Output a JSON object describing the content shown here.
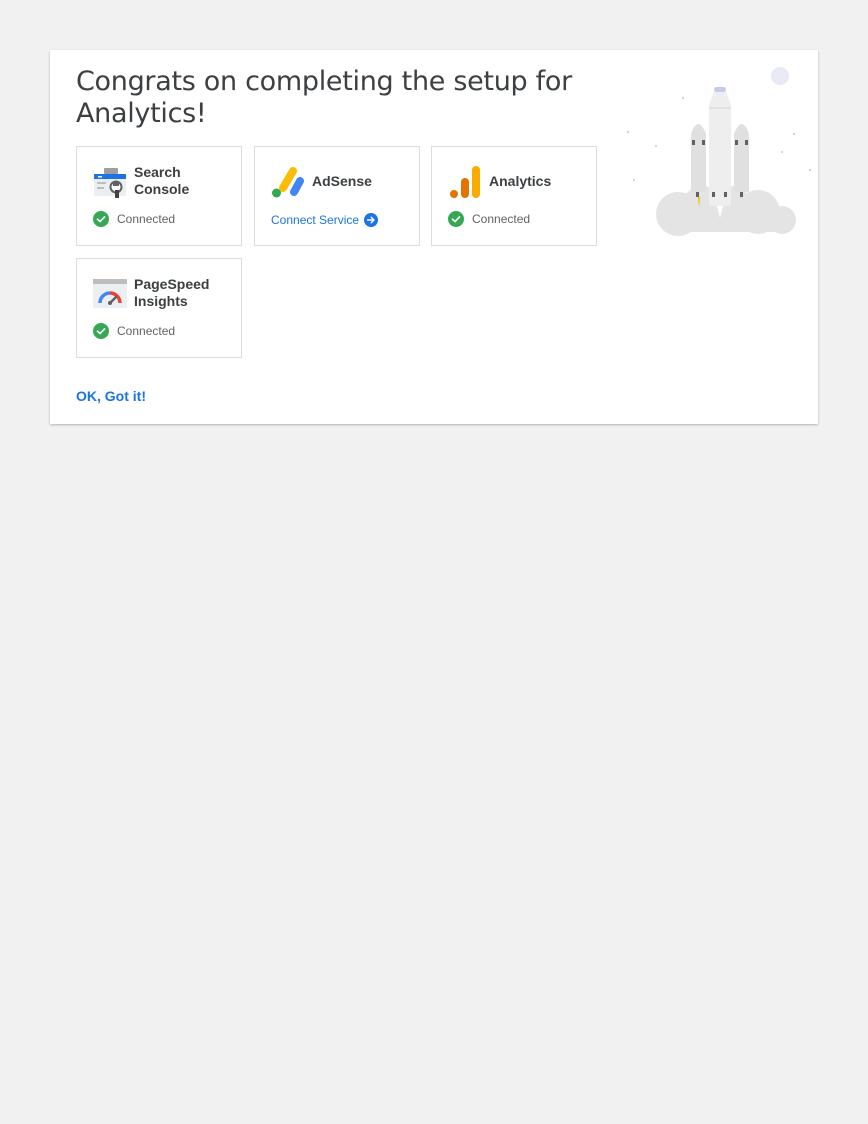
{
  "dialog": {
    "title": "Congrats on completing the setup for Analytics!",
    "ok_label": "OK, Got it!"
  },
  "services": [
    {
      "name": "Search Console",
      "status": "Connected",
      "icon": "search-console-icon"
    },
    {
      "name": "AdSense",
      "action_label": "Connect Service",
      "icon": "adsense-icon"
    },
    {
      "name": "Analytics",
      "status": "Connected",
      "icon": "analytics-icon"
    },
    {
      "name": "PageSpeed Insights",
      "status": "Connected",
      "icon": "pagespeed-insights-icon"
    }
  ],
  "colors": {
    "accent": "#1a73e8",
    "success": "#34a853",
    "title_text": "#3c4043",
    "border": "#dadce0"
  },
  "illustration": "rocket-launch-illustration"
}
